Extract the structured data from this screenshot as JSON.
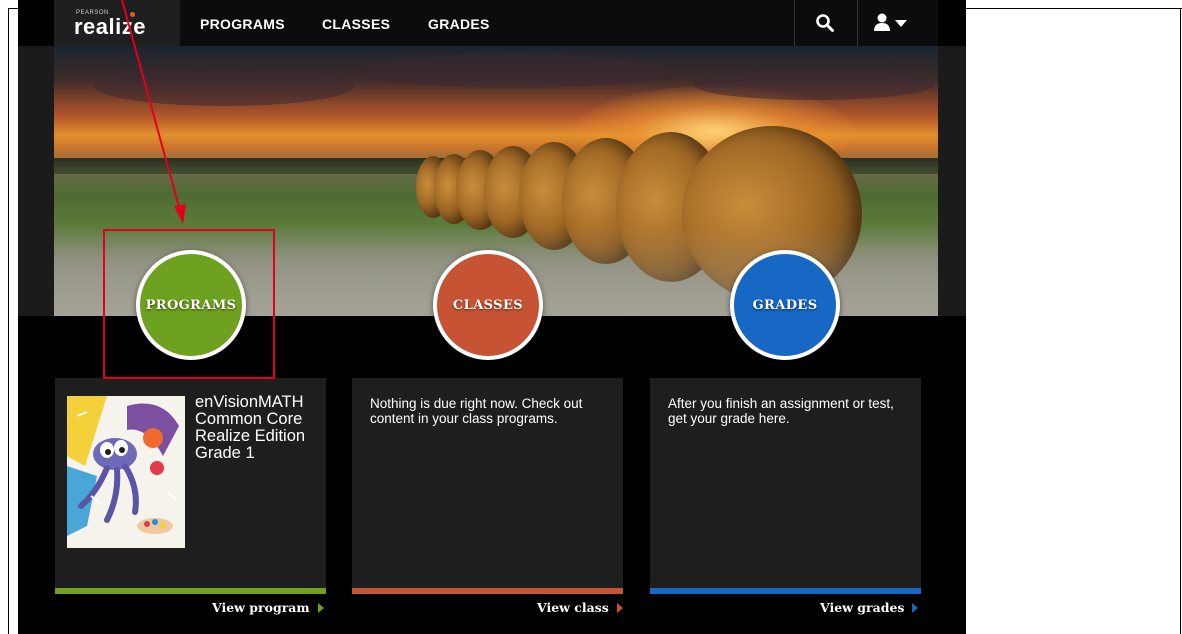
{
  "brand": {
    "small": "PEARSON",
    "name": "realize",
    "trailing": "."
  },
  "nav": {
    "programs": "PROGRAMS",
    "classes": "CLASSES",
    "grades": "GRADES"
  },
  "circles": {
    "programs": "PROGRAMS",
    "classes": "CLASSES",
    "grades": "GRADES"
  },
  "cards": {
    "program": {
      "title_line1": "enVisionMATH",
      "title_line2": "Common Core",
      "title_line3": "Realize Edition",
      "title_line4": "Grade 1",
      "link": "View program"
    },
    "class": {
      "text": "Nothing is due right now. Check out content in your class programs.",
      "link": "View class"
    },
    "grades": {
      "text": "After you finish an assignment or test, get your grade here.",
      "link": "View grades"
    }
  },
  "colors": {
    "programs": "#6ea11f",
    "classes": "#c65434",
    "grades": "#1767c4",
    "annotation": "#e2001a"
  },
  "icons": {
    "search": "search-icon",
    "user": "user-icon",
    "caret": "caret-down-icon"
  }
}
